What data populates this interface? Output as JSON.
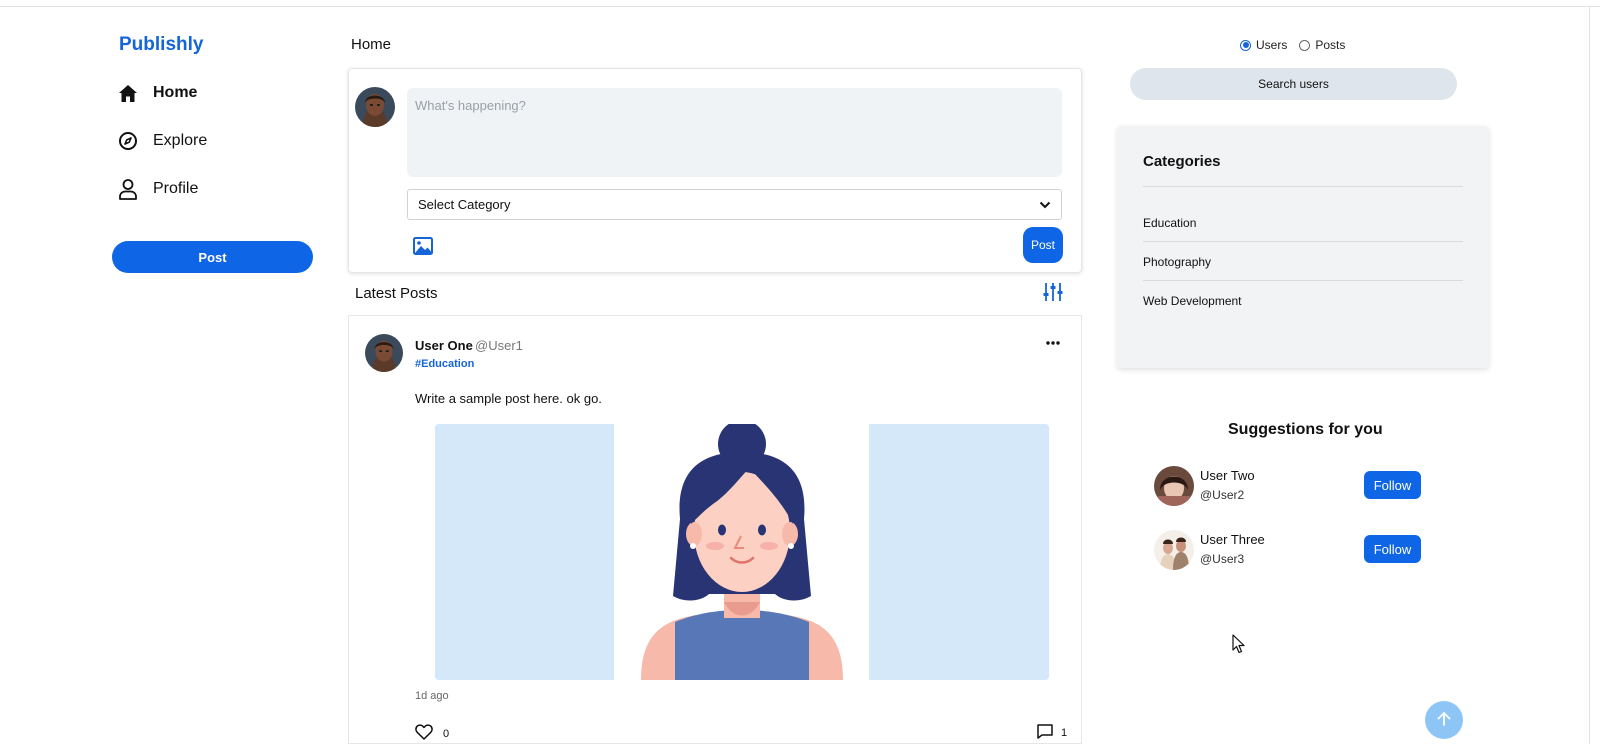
{
  "brand": "Publishly",
  "nav": [
    {
      "label": "Home",
      "icon": "home-icon",
      "active": true
    },
    {
      "label": "Explore",
      "icon": "compass-icon",
      "active": false
    },
    {
      "label": "Profile",
      "icon": "user-icon",
      "active": false
    }
  ],
  "sidebar_post_label": "Post",
  "page_title": "Home",
  "composer": {
    "placeholder": "What's happening?",
    "category_selected": "Select Category",
    "post_label": "Post"
  },
  "feed": {
    "title": "Latest Posts",
    "posts": [
      {
        "name": "User One",
        "handle": "@User1",
        "tag": "#Education",
        "text": "Write a sample post here. ok go.",
        "time": "1d ago",
        "likes": "0",
        "comments": "1"
      }
    ]
  },
  "search": {
    "options": [
      "Users",
      "Posts"
    ],
    "selected": "Users",
    "button_label": "Search users"
  },
  "categories": {
    "title": "Categories",
    "items": [
      "Education",
      "Photography",
      "Web Development"
    ]
  },
  "suggestions": {
    "title": "Suggestions for you",
    "users": [
      {
        "name": "User Two",
        "handle": "@User2",
        "button": "Follow"
      },
      {
        "name": "User Three",
        "handle": "@User3",
        "button": "Follow"
      }
    ]
  },
  "colors": {
    "accent": "#0e66e6",
    "brand": "#1565d8",
    "image_bg": "#d5e8fa"
  }
}
